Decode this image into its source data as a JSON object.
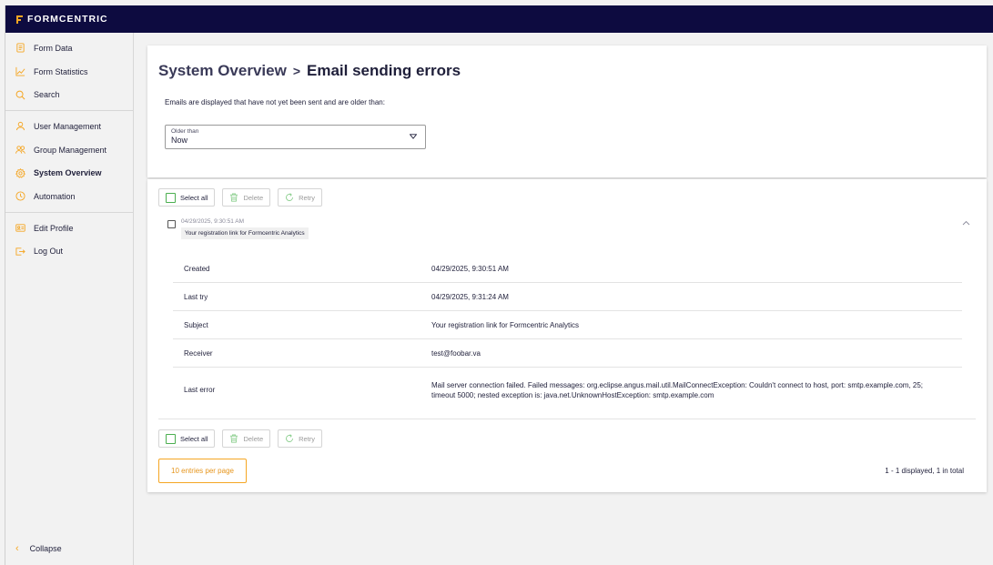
{
  "brand": {
    "name": "FORMCENTRIC",
    "accent": "#f5a623",
    "topbar_color": "#0d0b40"
  },
  "sidebar": {
    "groups": [
      [
        {
          "label": "Form Data",
          "icon": "document-icon"
        },
        {
          "label": "Form Statistics",
          "icon": "chart-line-icon"
        },
        {
          "label": "Search",
          "icon": "search-icon"
        }
      ],
      [
        {
          "label": "User Management",
          "icon": "user-icon"
        },
        {
          "label": "Group Management",
          "icon": "group-icon"
        },
        {
          "label": "System Overview",
          "icon": "gear-icon",
          "active": true
        },
        {
          "label": "Automation",
          "icon": "clock-icon"
        }
      ],
      [
        {
          "label": "Edit Profile",
          "icon": "id-card-icon"
        },
        {
          "label": "Log Out",
          "icon": "logout-icon"
        }
      ]
    ],
    "collapse_label": "Collapse"
  },
  "header": {
    "breadcrumb_parent": "System Overview",
    "breadcrumb_separator": ">",
    "breadcrumb_current": "Email sending errors",
    "description": "Emails are displayed that have not yet been sent and are older than:",
    "filter": {
      "label": "Older than",
      "value": "Now"
    }
  },
  "toolbar": {
    "select_all": "Select all",
    "delete": "Delete",
    "retry": "Retry"
  },
  "entry": {
    "date": "04/29/2025, 9:30:51 AM",
    "subject": "Your registration link for Formcentric Analytics",
    "details": [
      {
        "label": "Created",
        "value": "04/29/2025, 9:30:51 AM"
      },
      {
        "label": "Last try",
        "value": "04/29/2025, 9:31:24 AM"
      },
      {
        "label": "Subject",
        "value": "Your registration link for Formcentric Analytics"
      },
      {
        "label": "Receiver",
        "value": "test@foobar.va"
      },
      {
        "label": "Last error",
        "value": "Mail server connection failed. Failed messages: org.eclipse.angus.mail.util.MailConnectException: Couldn't connect to host, port: smtp.example.com, 25; timeout 5000; nested exception is: java.net.UnknownHostException: smtp.example.com"
      }
    ]
  },
  "pagination": {
    "per_page": "10 entries per page",
    "summary": "1 - 1 displayed, 1 in total"
  }
}
